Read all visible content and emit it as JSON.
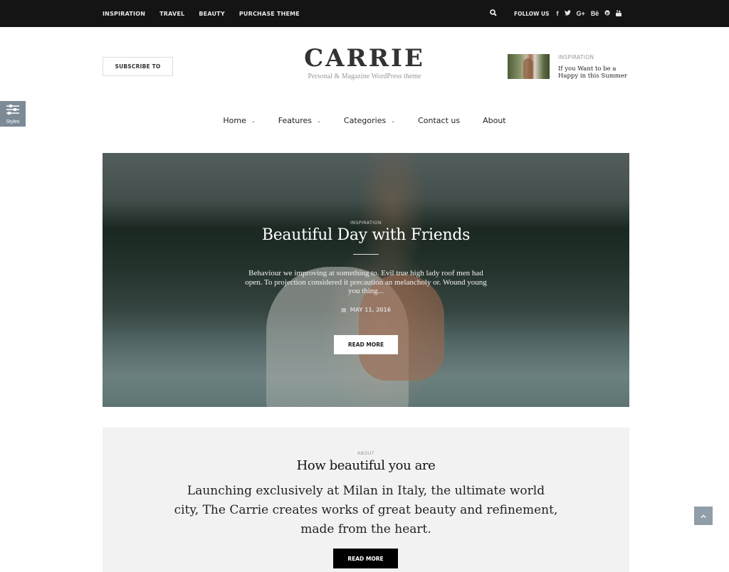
{
  "topbar": {
    "nav": [
      {
        "label": "INSPIRATION"
      },
      {
        "label": "TRAVEL"
      },
      {
        "label": "BEAUTY"
      },
      {
        "label": "PURCHASE THEME"
      }
    ],
    "search_icon": "search-icon",
    "follow_label": "FOLLOW US",
    "social": [
      {
        "name": "facebook",
        "glyph": "f"
      },
      {
        "name": "twitter",
        "glyph": "🐦"
      },
      {
        "name": "google-plus",
        "glyph": "G+"
      },
      {
        "name": "behance",
        "glyph": "Bē"
      },
      {
        "name": "pinterest",
        "glyph": "℗"
      },
      {
        "name": "youtube",
        "glyph": "▣"
      }
    ]
  },
  "header": {
    "subscribe_label": "SUBSCRIBE TO",
    "logo": "CARRIE",
    "tagline": "Personal & Magazine WordPress theme",
    "featured": {
      "category": "INSPIRATION",
      "title_line1": "If you Want to be a",
      "title_line2": "Happy in this Summer"
    }
  },
  "styles_panel": {
    "label": "Styles"
  },
  "mainnav": [
    {
      "label": "Home",
      "has_dropdown": true
    },
    {
      "label": "Features",
      "has_dropdown": true
    },
    {
      "label": "Categories",
      "has_dropdown": true
    },
    {
      "label": "Contact us",
      "has_dropdown": false
    },
    {
      "label": "About",
      "has_dropdown": false
    }
  ],
  "hero": {
    "category": "INSPIRATION",
    "title": "Beautiful Day with Friends",
    "excerpt": "Behaviour we improving at something to. Evil true high lady roof men had open. To projection considered it precaution an melancholy or. Wound young you thing...",
    "date": "MAY 11, 2016",
    "read_more": "READ MORE"
  },
  "about": {
    "category": "ABOUT",
    "title": "How beautiful you are",
    "text": "Launching exclusively at Milan in Italy, the ultimate world city, The Carrie creates works of great beauty and refinement, made from the heart.",
    "read_more": "READ MORE"
  },
  "back_to_top": "^"
}
